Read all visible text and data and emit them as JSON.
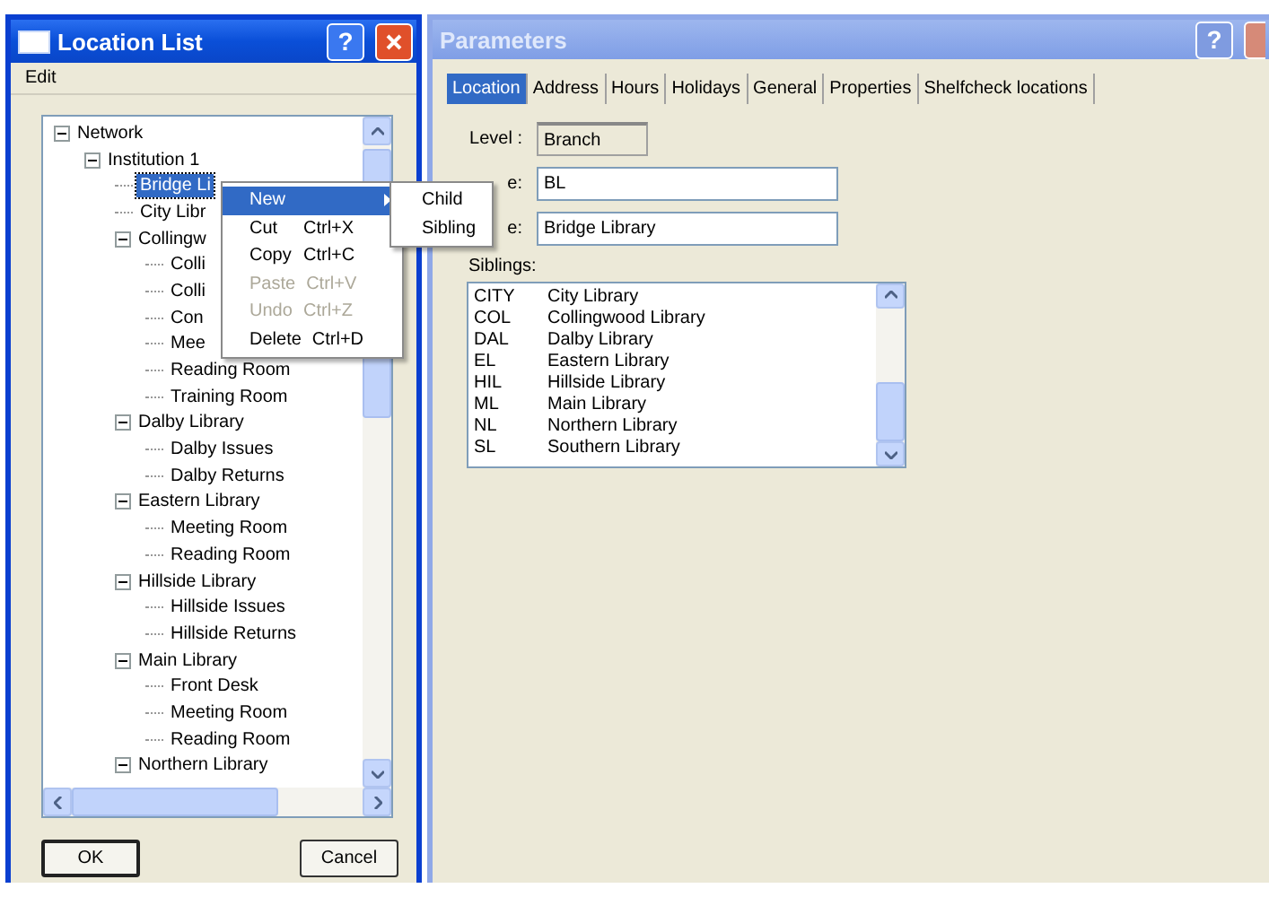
{
  "location_list": {
    "title": "Location List",
    "help": "?",
    "menu": [
      "Edit"
    ],
    "tree": {
      "items": [
        {
          "label": "Network",
          "expanded": true,
          "selected": false,
          "children": [
            {
              "label": "Institution 1",
              "expanded": true,
              "selected": false,
              "children": [
                {
                  "label": "Bridge Li",
                  "selected": true
                },
                {
                  "label": "City Libr",
                  "selected": false
                },
                {
                  "label": "Collingw",
                  "expanded": true,
                  "selected": false,
                  "children": [
                    {
                      "label": "Colli",
                      "selected": false
                    },
                    {
                      "label": "Colli",
                      "selected": false
                    },
                    {
                      "label": "Con",
                      "selected": false
                    },
                    {
                      "label": "Mee",
                      "selected": false
                    },
                    {
                      "label": "Reading Room",
                      "selected": false
                    },
                    {
                      "label": "Training Room",
                      "selected": false
                    }
                  ]
                },
                {
                  "label": "Dalby Library",
                  "expanded": true,
                  "selected": false,
                  "children": [
                    {
                      "label": "Dalby Issues",
                      "selected": false
                    },
                    {
                      "label": "Dalby Returns",
                      "selected": false
                    }
                  ]
                },
                {
                  "label": "Eastern Library",
                  "expanded": true,
                  "selected": false,
                  "children": [
                    {
                      "label": "Meeting Room",
                      "selected": false
                    },
                    {
                      "label": "Reading Room",
                      "selected": false
                    }
                  ]
                },
                {
                  "label": "Hillside Library",
                  "expanded": true,
                  "selected": false,
                  "children": [
                    {
                      "label": "Hillside Issues",
                      "selected": false
                    },
                    {
                      "label": "Hillside Returns",
                      "selected": false
                    }
                  ]
                },
                {
                  "label": "Main Library",
                  "expanded": true,
                  "selected": false,
                  "children": [
                    {
                      "label": "Front Desk",
                      "selected": false
                    },
                    {
                      "label": "Meeting Room",
                      "selected": false
                    },
                    {
                      "label": "Reading Room",
                      "selected": false
                    }
                  ]
                },
                {
                  "label": "Northern Library",
                  "expanded": true,
                  "selected": false
                }
              ]
            }
          ]
        }
      ]
    },
    "buttons": [
      "OK",
      "Cancel"
    ]
  },
  "context_menu": {
    "items": [
      {
        "label": "New",
        "submenu": true,
        "selected": true,
        "disabled": false
      },
      {
        "label": "Cut",
        "shortcut": "Ctrl+X",
        "selected": false,
        "disabled": false
      },
      {
        "label": "Copy",
        "shortcut": "Ctrl+C",
        "selected": false,
        "disabled": false
      },
      {
        "label": "Paste",
        "shortcut": "Ctrl+V",
        "selected": false,
        "disabled": true
      },
      {
        "label": "Undo",
        "shortcut": "Ctrl+Z",
        "selected": false,
        "disabled": true
      },
      {
        "label": "Delete",
        "shortcut": "Ctrl+D",
        "selected": false,
        "disabled": false
      }
    ],
    "submenu": [
      "Child",
      "Sibling"
    ]
  },
  "parameters": {
    "title": "Parameters",
    "help": "?",
    "tabs": [
      {
        "label": "Location",
        "selected": true
      },
      {
        "label": "Address",
        "selected": false
      },
      {
        "label": "Hours",
        "selected": false
      },
      {
        "label": "Holidays",
        "selected": false
      },
      {
        "label": "General",
        "selected": false
      },
      {
        "label": "Properties",
        "selected": false
      },
      {
        "label": "Shelfcheck locations",
        "selected": false
      }
    ],
    "level": {
      "label": "Level :",
      "value": "Branch"
    },
    "code": {
      "label": "e:",
      "value": "BL"
    },
    "name": {
      "label": "e:",
      "value": "Bridge Library"
    },
    "siblings_label": "Siblings:",
    "siblings": [
      {
        "code": "CITY",
        "name": "City Library",
        "selected": false
      },
      {
        "code": "COL",
        "name": "Collingwood Library",
        "selected": false
      },
      {
        "code": "DAL",
        "name": "Dalby Library",
        "selected": false
      },
      {
        "code": "EL",
        "name": "Eastern Library",
        "selected": false
      },
      {
        "code": "HIL",
        "name": "Hillside Library",
        "selected": false
      },
      {
        "code": "ML",
        "name": "Main Library",
        "selected": false
      },
      {
        "code": "NL",
        "name": "Northern Library",
        "selected": false
      },
      {
        "code": "SL",
        "name": "Southern Library",
        "selected": false
      }
    ]
  }
}
